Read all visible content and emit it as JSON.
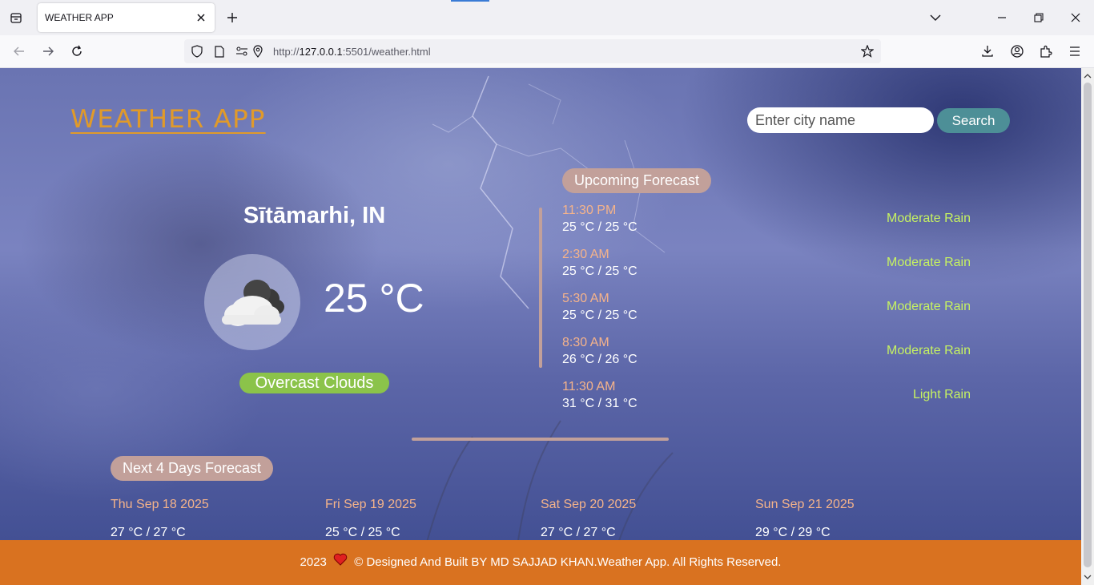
{
  "browser": {
    "tab_title": "WEATHER APP",
    "url_prefix": "http://",
    "url_host": "127.0.0.1",
    "url_rest": ":5501/weather.html"
  },
  "app": {
    "logo": "WEATHER APP",
    "search_placeholder": "Enter city name",
    "search_button": "Search"
  },
  "current": {
    "city": "Sītāmarhi, IN",
    "temperature": "25 °C",
    "condition": "Overcast Clouds",
    "icon": "overcast-clouds-icon"
  },
  "upcoming": {
    "title": "Upcoming Forecast",
    "items": [
      {
        "time": "11:30 PM",
        "temp": "25 °C / 25 °C",
        "desc": "Moderate Rain"
      },
      {
        "time": "2:30 AM",
        "temp": "25 °C / 25 °C",
        "desc": "Moderate Rain"
      },
      {
        "time": "5:30 AM",
        "temp": "25 °C / 25 °C",
        "desc": "Moderate Rain"
      },
      {
        "time": "8:30 AM",
        "temp": "26 °C / 26 °C",
        "desc": "Moderate Rain"
      },
      {
        "time": "11:30 AM",
        "temp": "31 °C / 31 °C",
        "desc": "Light Rain"
      }
    ]
  },
  "next_days": {
    "title": "Next 4 Days Forecast",
    "items": [
      {
        "date": "Thu Sep 18 2025",
        "temp": "27 °C / 27 °C"
      },
      {
        "date": "Fri Sep 19 2025",
        "temp": "25 °C / 25 °C"
      },
      {
        "date": "Sat Sep 20 2025",
        "temp": "27 °C / 27 °C"
      },
      {
        "date": "Sun Sep 21 2025",
        "temp": "29 °C / 29 °C"
      }
    ]
  },
  "footer": {
    "year": "2023",
    "text": "© Designed And Built BY MD SAJJAD KHAN.Weather App. All Rights Reserved."
  },
  "colors": {
    "logo": "#e09a2a",
    "footer": "#d97220",
    "condition_pill": "#8bc34a",
    "section_pill": "#c2a09a",
    "time_text": "#f5b38a",
    "desc_text": "#c6f261",
    "search_button": "#4d8f97"
  }
}
